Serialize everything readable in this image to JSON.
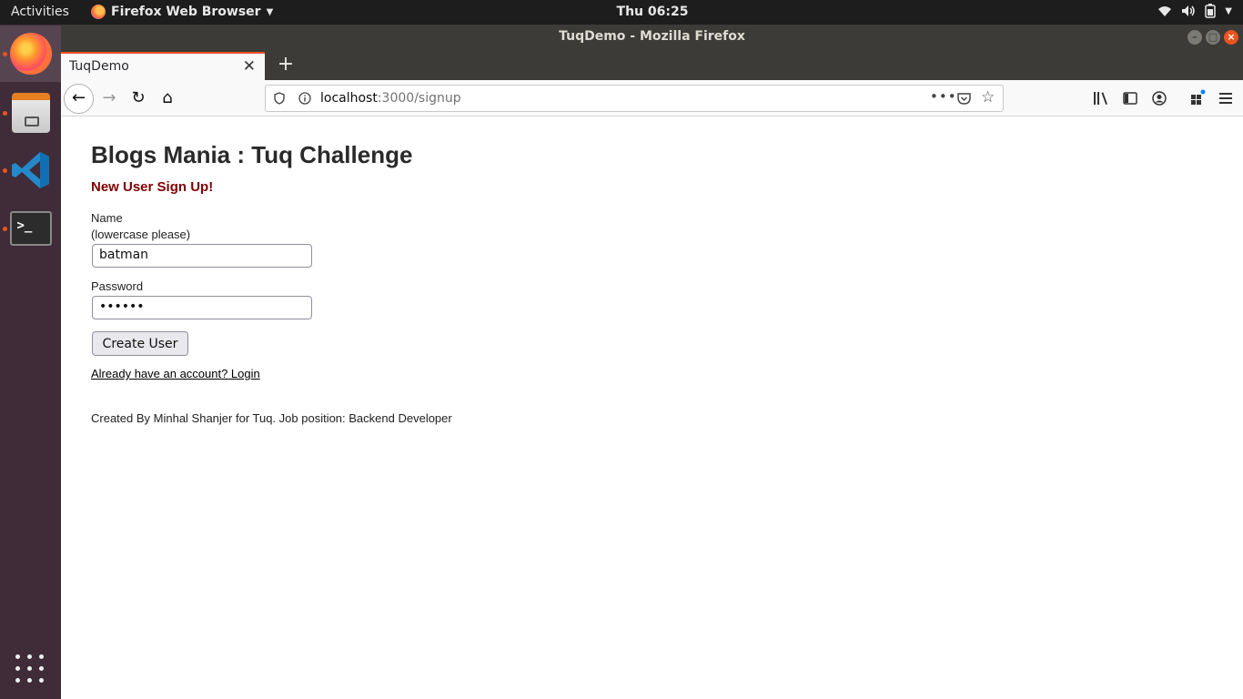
{
  "topbar": {
    "activities": "Activities",
    "app_name": "Firefox Web Browser",
    "clock": "Thu 06:25"
  },
  "window": {
    "title": "TuqDemo - Mozilla Firefox"
  },
  "tabs": [
    {
      "label": "TuqDemo",
      "active": true
    }
  ],
  "urlbar": {
    "host": "localhost",
    "path": ":3000/signup"
  },
  "page": {
    "heading": "Blogs Mania : Tuq Challenge",
    "subheading": "New User Sign Up!",
    "name_label": "Name",
    "name_hint": "(lowercase please)",
    "name_value": "batman",
    "password_label": "Password",
    "password_value": "••••••",
    "create_button": "Create User",
    "login_link": "Already have an account? Login",
    "footer": "Created By Minhal Shanjer for Tuq. Job position: Backend Developer"
  },
  "colors": {
    "accent": "#e95420",
    "subheading": "#800000",
    "dock_bg": "#3f2c38",
    "topbar_bg": "#1d1d1d"
  },
  "icons": {
    "dock": [
      "firefox-icon",
      "files-icon",
      "vscode-icon",
      "terminal-icon",
      "app-grid-icon"
    ],
    "tray": [
      "wifi-icon",
      "volume-icon",
      "battery-icon",
      "tray-menu-icon"
    ]
  }
}
